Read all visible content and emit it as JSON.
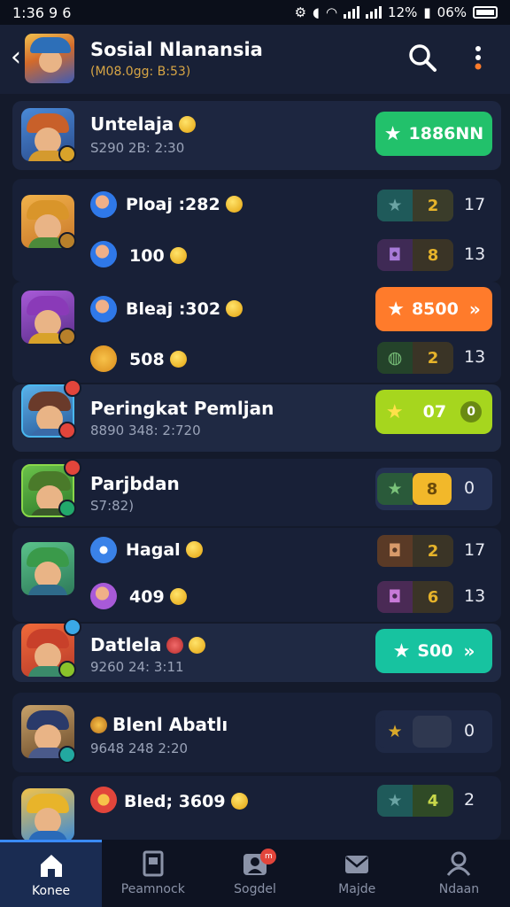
{
  "status_bar": {
    "time": "1:36 9 6",
    "wifi_pct": "12%",
    "battery": "06%"
  },
  "header": {
    "title": "Sosial Nlanansia",
    "subtitle": "(M08.0gg: B:53)"
  },
  "rows": [
    {
      "name": "Untelaja",
      "time": "S290 2B: 2:30",
      "pill": "1886NN"
    },
    {
      "sub1": "Ploaj :282",
      "split1": "2",
      "count1": "17",
      "sub2": "100",
      "split2": "8",
      "count2": "13"
    },
    {
      "sub1": "Bleaj :302",
      "pill": "8500",
      "sub2": "508",
      "split2": "2",
      "count2": "13"
    },
    {
      "name": "Peringkat Pemljan",
      "time": "8890 348: 2:720",
      "pill_left": "07",
      "pill_right": "0"
    },
    {
      "name": "Parjbdan",
      "time": "S7:82)",
      "split": "8",
      "count": "0"
    },
    {
      "sub1": "Hagal",
      "split1": "2",
      "count1": "17",
      "sub2": "409",
      "split2": "6",
      "count2": "13"
    },
    {
      "name": "Datlela",
      "time": "9260 24: 3:11",
      "pill": "S00"
    },
    {
      "name": "Blenl Abatlı",
      "time": "9648 248 2:20",
      "count": "0"
    },
    {
      "sub1": "Bled; 3609",
      "split1": "4",
      "count1": "2"
    }
  ],
  "nav": [
    {
      "label": "Konee",
      "icon": "home-icon"
    },
    {
      "label": "Peamnock",
      "icon": "bookmark-icon"
    },
    {
      "label": "Sogdel",
      "icon": "social-icon",
      "badge": "m"
    },
    {
      "label": "Majde",
      "icon": "mail-icon"
    },
    {
      "label": "Ndaan",
      "icon": "profile-icon"
    }
  ],
  "colors": {
    "green": "#22c16b",
    "orange": "#ff7b2b",
    "lime": "#a6d61e",
    "teal": "#17c3a0",
    "bg": "#141a2b"
  }
}
